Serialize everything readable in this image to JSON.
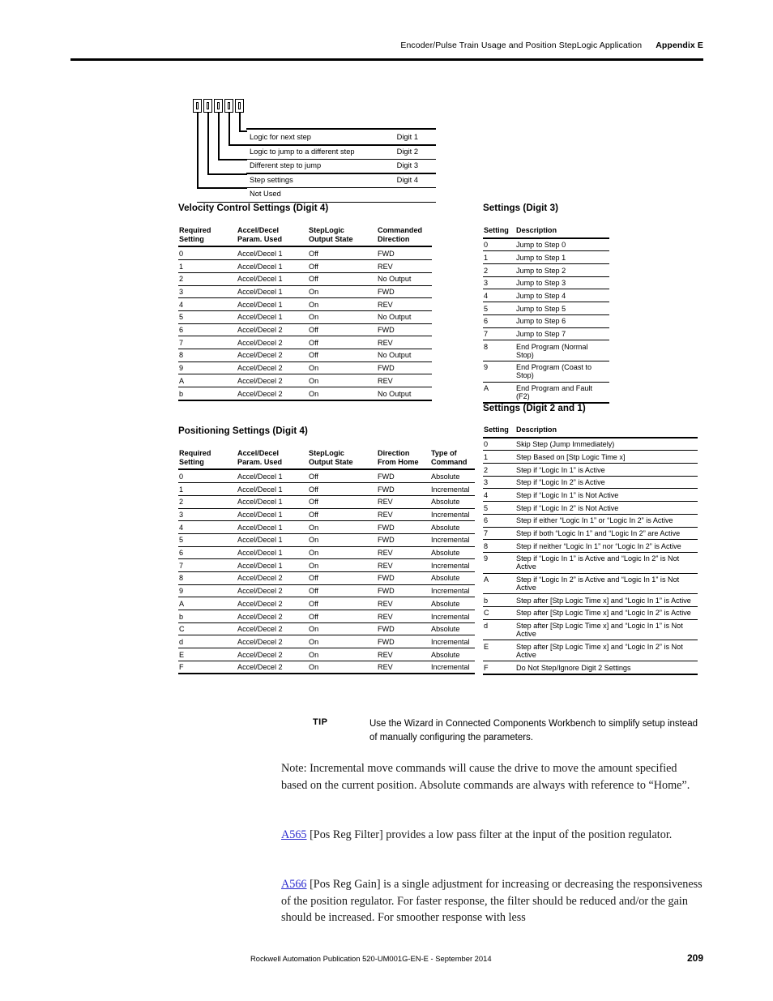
{
  "header": {
    "title": "Encoder/Pulse Train Usage and Position StepLogic Application",
    "appendix": "Appendix E"
  },
  "diagram": {
    "box_count": 5,
    "rows": [
      {
        "label": "Logic for next step",
        "digit": "Digit 1"
      },
      {
        "label": "Logic to jump to a different step",
        "digit": "Digit 2"
      },
      {
        "label": "Different step to jump",
        "digit": "Digit 3"
      },
      {
        "label": "Step settings",
        "digit": "Digit 4"
      },
      {
        "label": "Not Used",
        "digit": ""
      }
    ]
  },
  "velocity": {
    "title": "Velocity Control Settings (Digit 4)",
    "columns": [
      "Required\nSetting",
      "Accel/Decel\nParam. Used",
      "StepLogic\nOutput State",
      "Commanded\nDirection"
    ],
    "columns_flat": [
      "Required Setting",
      "Accel/Decel Param. Used",
      "StepLogic Output State",
      "Commanded Direction"
    ],
    "rows": [
      [
        "0",
        "Accel/Decel 1",
        "Off",
        "FWD"
      ],
      [
        "1",
        "Accel/Decel 1",
        "Off",
        "REV"
      ],
      [
        "2",
        "Accel/Decel 1",
        "Off",
        "No Output"
      ],
      [
        "3",
        "Accel/Decel 1",
        "On",
        "FWD"
      ],
      [
        "4",
        "Accel/Decel 1",
        "On",
        "REV"
      ],
      [
        "5",
        "Accel/Decel 1",
        "On",
        "No Output"
      ],
      [
        "6",
        "Accel/Decel 2",
        "Off",
        "FWD"
      ],
      [
        "7",
        "Accel/Decel 2",
        "Off",
        "REV"
      ],
      [
        "8",
        "Accel/Decel 2",
        "Off",
        "No Output"
      ],
      [
        "9",
        "Accel/Decel 2",
        "On",
        "FWD"
      ],
      [
        "A",
        "Accel/Decel 2",
        "On",
        "REV"
      ],
      [
        "b",
        "Accel/Decel 2",
        "On",
        "No Output"
      ]
    ]
  },
  "positioning": {
    "title": "Positioning Settings (Digit 4)",
    "columns_flat": [
      "Required Setting",
      "Accel/Decel Param. Used",
      "StepLogic Output State",
      "Direction From Home",
      "Type of Command"
    ],
    "rows": [
      [
        "0",
        "Accel/Decel 1",
        "Off",
        "FWD",
        "Absolute"
      ],
      [
        "1",
        "Accel/Decel 1",
        "Off",
        "FWD",
        "Incremental"
      ],
      [
        "2",
        "Accel/Decel 1",
        "Off",
        "REV",
        "Absolute"
      ],
      [
        "3",
        "Accel/Decel 1",
        "Off",
        "REV",
        "Incremental"
      ],
      [
        "4",
        "Accel/Decel 1",
        "On",
        "FWD",
        "Absolute"
      ],
      [
        "5",
        "Accel/Decel 1",
        "On",
        "FWD",
        "Incremental"
      ],
      [
        "6",
        "Accel/Decel 1",
        "On",
        "REV",
        "Absolute"
      ],
      [
        "7",
        "Accel/Decel 1",
        "On",
        "REV",
        "Incremental"
      ],
      [
        "8",
        "Accel/Decel 2",
        "Off",
        "FWD",
        "Absolute"
      ],
      [
        "9",
        "Accel/Decel 2",
        "Off",
        "FWD",
        "Incremental"
      ],
      [
        "A",
        "Accel/Decel 2",
        "Off",
        "REV",
        "Absolute"
      ],
      [
        "b",
        "Accel/Decel 2",
        "Off",
        "REV",
        "Incremental"
      ],
      [
        "C",
        "Accel/Decel 2",
        "On",
        "FWD",
        "Absolute"
      ],
      [
        "d",
        "Accel/Decel 2",
        "On",
        "FWD",
        "Incremental"
      ],
      [
        "E",
        "Accel/Decel 2",
        "On",
        "REV",
        "Absolute"
      ],
      [
        "F",
        "Accel/Decel 2",
        "On",
        "REV",
        "Incremental"
      ]
    ]
  },
  "digit3": {
    "title": "Settings (Digit 3)",
    "columns_flat": [
      "Setting",
      "Description"
    ],
    "rows": [
      [
        "0",
        "Jump to Step 0"
      ],
      [
        "1",
        "Jump to Step 1"
      ],
      [
        "2",
        "Jump to Step 2"
      ],
      [
        "3",
        "Jump to Step 3"
      ],
      [
        "4",
        "Jump to Step 4"
      ],
      [
        "5",
        "Jump to Step 5"
      ],
      [
        "6",
        "Jump to Step 6"
      ],
      [
        "7",
        "Jump to Step 7"
      ],
      [
        "8",
        "End Program (Normal Stop)"
      ],
      [
        "9",
        "End Program (Coast to Stop)"
      ],
      [
        "A",
        "End Program and Fault (F2)"
      ]
    ]
  },
  "digit21": {
    "title": "Settings (Digit 2 and 1)",
    "columns_flat": [
      "Setting",
      "Description"
    ],
    "rows": [
      [
        "0",
        "Skip Step (Jump Immediately)"
      ],
      [
        "1",
        "Step Based on [Stp Logic Time x]"
      ],
      [
        "2",
        "Step if “Logic In 1” is Active"
      ],
      [
        "3",
        "Step if “Logic In 2” is Active"
      ],
      [
        "4",
        "Step if “Logic In 1” is Not Active"
      ],
      [
        "5",
        "Step if “Logic In 2” is Not Active"
      ],
      [
        "6",
        "Step if either “Logic In 1” or “Logic In 2” is Active"
      ],
      [
        "7",
        "Step if both “Logic In 1” and “Logic In 2” are Active"
      ],
      [
        "8",
        "Step if neither “Logic In 1” nor “Logic In 2” is Active"
      ],
      [
        "9",
        "Step if “Logic In 1” is Active and “Logic In 2” is Not Active"
      ],
      [
        "A",
        "Step if “Logic In 2” is Active and “Logic In 1” is Not Active"
      ],
      [
        "b",
        "Step after [Stp Logic Time x] and “Logic In 1” is Active"
      ],
      [
        "C",
        "Step after [Stp Logic Time x] and “Logic In 2” is Active"
      ],
      [
        "d",
        "Step after [Stp Logic Time x] and “Logic In 1” is Not Active"
      ],
      [
        "E",
        "Step after [Stp Logic Time x] and “Logic In 2” is Not Active"
      ],
      [
        "F",
        "Do Not Step/Ignore Digit 2 Settings"
      ]
    ]
  },
  "tip": {
    "label": "TIP",
    "text": "Use the Wizard in Connected Components Workbench to simplify setup instead of manually configuring the parameters."
  },
  "note": {
    "text": "Note: Incremental move commands will cause the drive to move the amount specified based on the current position. Absolute commands are always with reference to “Home”."
  },
  "param_a565": {
    "link": "A565",
    "text": " [Pos Reg Filter] provides a low pass filter at the input of the position regulator."
  },
  "param_a566": {
    "link": "A566",
    "text": " [Pos Reg Gain] is a single adjustment for increasing or decreasing the responsiveness of the position regulator. For faster response, the filter should be reduced and/or the gain should be increased. For smoother response with less"
  },
  "footer": {
    "text": "Rockwell Automation Publication 520-UM001G-EN-E - September 2014",
    "page": "209"
  },
  "colors": {
    "link": "#2b2bcf",
    "rule": "#000000"
  }
}
